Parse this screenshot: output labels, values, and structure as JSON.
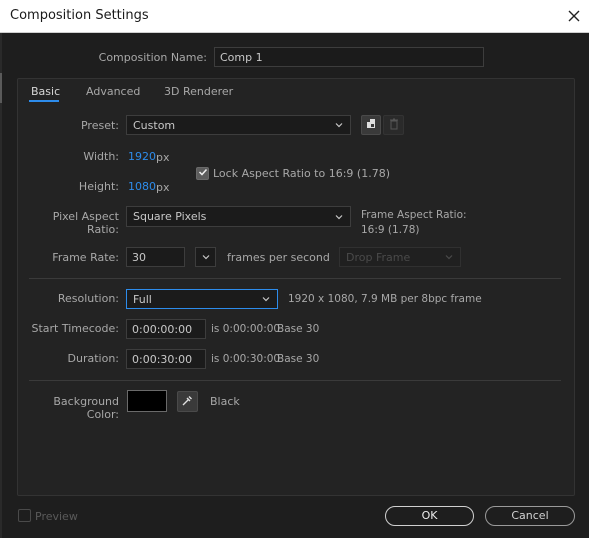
{
  "window": {
    "title": "Composition Settings"
  },
  "composition_name": {
    "label": "Composition Name:",
    "value": "Comp 1"
  },
  "tabs": [
    {
      "label": "Basic",
      "active": true
    },
    {
      "label": "Advanced",
      "active": false
    },
    {
      "label": "3D Renderer",
      "active": false
    }
  ],
  "preset": {
    "label": "Preset:",
    "value": "Custom"
  },
  "width": {
    "label": "Width:",
    "value": "1920",
    "unit": "px"
  },
  "height": {
    "label": "Height:",
    "value": "1080",
    "unit": "px"
  },
  "lock_aspect": {
    "label": "Lock Aspect Ratio to 16:9 (1.78)",
    "checked": true
  },
  "pixel_aspect": {
    "label": "Pixel Aspect Ratio:",
    "value": "Square Pixels"
  },
  "frame_aspect": {
    "line1": "Frame Aspect Ratio:",
    "line2": "16:9 (1.78)"
  },
  "frame_rate": {
    "label": "Frame Rate:",
    "value": "30",
    "unit": "frames per second",
    "drop_frame": "Drop Frame"
  },
  "resolution": {
    "label": "Resolution:",
    "value": "Full",
    "info": "1920 x 1080, 7.9 MB per 8bpc frame"
  },
  "start_timecode": {
    "label": "Start Timecode:",
    "value": "0:00:00:00",
    "info_is": "is 0:00:00:00",
    "base": "Base 30"
  },
  "duration": {
    "label": "Duration:",
    "value": "0:00:30:00",
    "info_is": "is 0:00:30:00",
    "base": "Base 30"
  },
  "background": {
    "label": "Background Color:",
    "color": "#000000",
    "name": "Black"
  },
  "footer": {
    "preview_label": "Preview",
    "ok_label": "OK",
    "cancel_label": "Cancel"
  },
  "colors": {
    "accent": "#2d8ceb",
    "panel": "#232323",
    "background": "#1e1e1e"
  }
}
